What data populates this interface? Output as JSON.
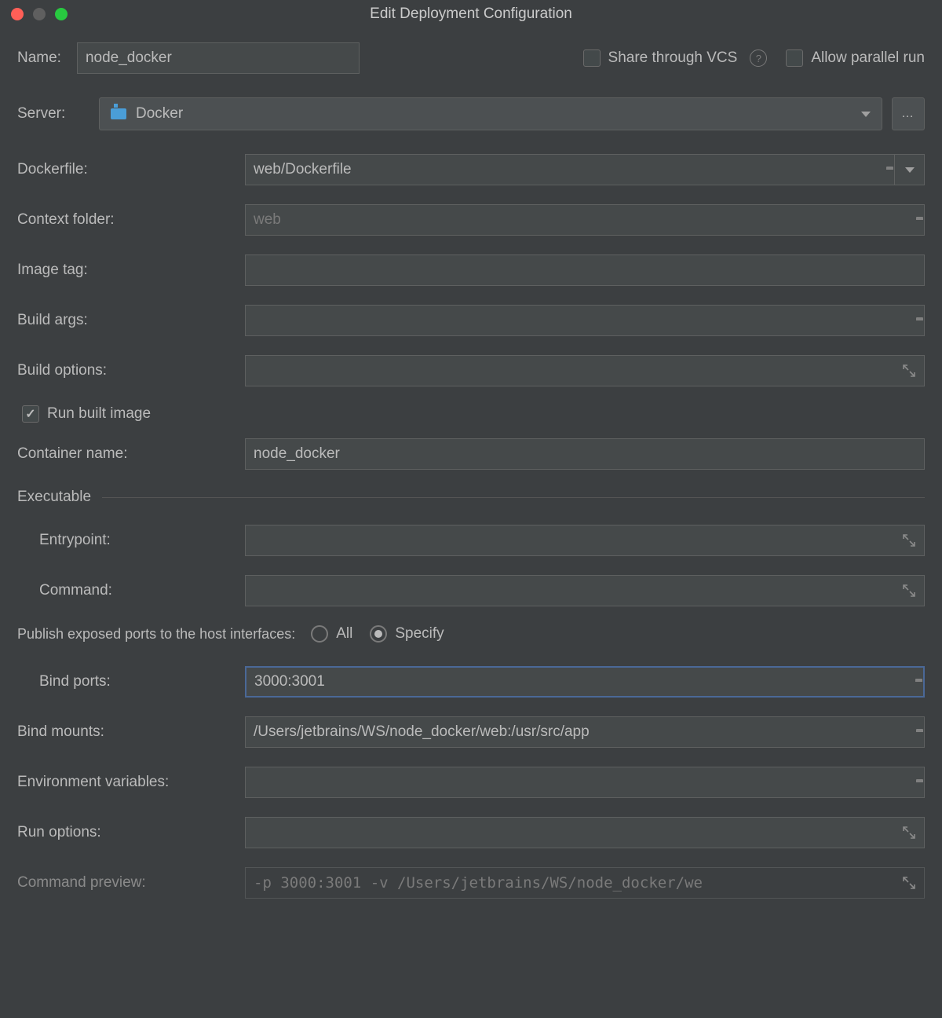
{
  "window": {
    "title": "Edit Deployment Configuration"
  },
  "topbar": {
    "name_label": "Name:",
    "name_value": "node_docker",
    "share_label": "Share through VCS",
    "allow_parallel_label": "Allow parallel run"
  },
  "server": {
    "label": "Server:",
    "value": "Docker"
  },
  "fields": {
    "dockerfile_label": "Dockerfile:",
    "dockerfile_value": "web/Dockerfile",
    "context_label": "Context folder:",
    "context_placeholder": "web",
    "image_tag_label": "Image tag:",
    "image_tag_value": "",
    "build_args_label": "Build args:",
    "build_args_value": "",
    "build_options_label": "Build options:",
    "build_options_value": "",
    "run_built_image_label": "Run built image",
    "container_name_label": "Container name:",
    "container_name_value": "node_docker"
  },
  "executable": {
    "section": "Executable",
    "entrypoint_label": "Entrypoint:",
    "entrypoint_value": "",
    "command_label": "Command:",
    "command_value": ""
  },
  "ports": {
    "publish_label": "Publish exposed ports to the host interfaces:",
    "all_label": "All",
    "specify_label": "Specify",
    "bind_ports_label": "Bind ports:",
    "bind_ports_value": "3000:3001"
  },
  "mounts": {
    "bind_mounts_label": "Bind mounts:",
    "bind_mounts_value": "/Users/jetbrains/WS/node_docker/web:/usr/src/app",
    "env_label": "Environment variables:",
    "env_value": "",
    "run_options_label": "Run options:",
    "run_options_value": "",
    "preview_label": "Command preview:",
    "preview_value": "-p 3000:3001 -v /Users/jetbrains/WS/node_docker/we"
  }
}
